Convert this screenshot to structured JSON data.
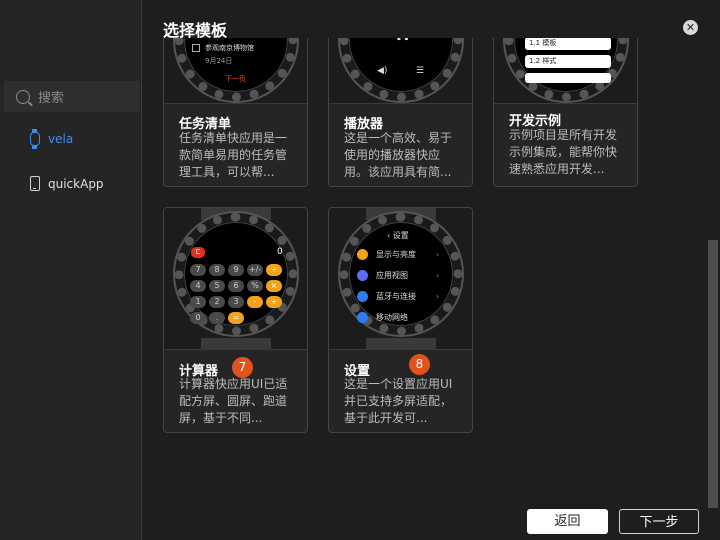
{
  "dialog": {
    "title": "选择模板"
  },
  "sidebar": {
    "search_placeholder": "搜索",
    "items": [
      {
        "label": "vela",
        "icon": "watch-icon"
      },
      {
        "label": "quickApp",
        "icon": "phone-icon"
      }
    ]
  },
  "cards": [
    {
      "title": "任务清单",
      "description": "任务清单快应用是一款简单易用的任务管理工具，可以帮...",
      "preview": {
        "item": "参观南京博物馆",
        "date": "9月24日",
        "next": "下一页"
      }
    },
    {
      "title": "播放器",
      "description": "这是一个高效、易于使用的播放器快应用。该应用具有简...",
      "preview": {}
    },
    {
      "title": "开发示例",
      "description": "示例项目是所有开发示例集成，能帮你快速熟悉应用开发...",
      "preview": {
        "row1": "1.1 模板",
        "row2": "1.2 样式"
      }
    },
    {
      "title": "计算器",
      "badge": "7",
      "description": "计算器快应用UI已适配方屏、圆屏、跑道屏，基于不同...",
      "preview": {
        "display": "0",
        "clear": "C",
        "keys": [
          "7",
          "8",
          "9",
          "+/-",
          "÷",
          "4",
          "5",
          "6",
          "%",
          "×",
          "1",
          "2",
          "3",
          "-",
          "+",
          "0",
          ".",
          "="
        ]
      }
    },
    {
      "title": "设置",
      "badge": "8",
      "description": "这是一个设置应用UI并已支持多屏适配，基于此开发可...",
      "preview": {
        "header": "设置",
        "rows": [
          "显示与亮度",
          "应用视图",
          "蓝牙与连接",
          "移动网络"
        ]
      }
    }
  ],
  "footer": {
    "back_label": "返回",
    "next_label": "下一步"
  },
  "colors": {
    "accent": "#3c8ff0",
    "badge": "#e2531c",
    "calc_operator": "#f2a21b"
  }
}
